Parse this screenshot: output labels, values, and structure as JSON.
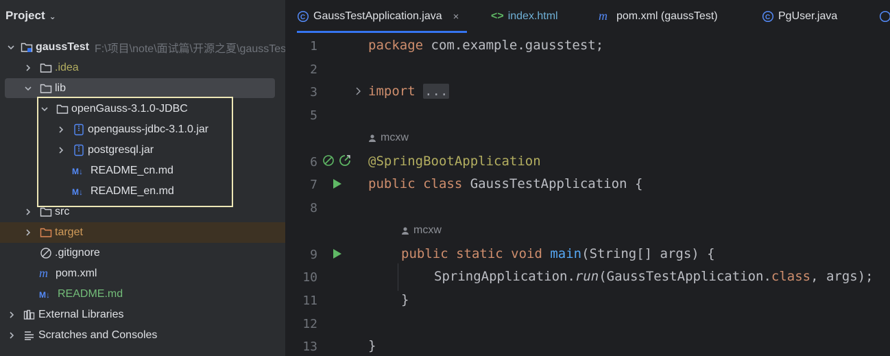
{
  "panel": {
    "title": "Project",
    "tree": [
      {
        "label": "gaussTest",
        "path": "F:\\项目\\note\\面试篇\\开源之夏\\gaussTest"
      },
      {
        "label": ".idea"
      },
      {
        "label": "lib"
      },
      {
        "label": "openGauss-3.1.0-JDBC"
      },
      {
        "label": "opengauss-jdbc-3.1.0.jar"
      },
      {
        "label": "postgresql.jar"
      },
      {
        "label": "README_cn.md"
      },
      {
        "label": "README_en.md"
      },
      {
        "label": "src"
      },
      {
        "label": "target"
      },
      {
        "label": ".gitignore"
      },
      {
        "label": "pom.xml"
      },
      {
        "label": "README.md"
      },
      {
        "label": "External Libraries"
      },
      {
        "label": "Scratches and Consoles"
      }
    ]
  },
  "tabs": [
    {
      "label": "GaussTestApplication.java",
      "close": "×"
    },
    {
      "label": "index.html"
    },
    {
      "label": "pom.xml (gaussTest)"
    },
    {
      "label": "PgUser.java"
    }
  ],
  "editor": {
    "gutter": [
      "1",
      "2",
      "3",
      "5",
      "6",
      "7",
      "8",
      "9",
      "10",
      "11",
      "12",
      "13"
    ],
    "author": "mcxw",
    "lines": {
      "l1_kw": "package",
      "l1_rest": " com.example.gausstest;",
      "l3_kw": "import",
      "l3_dots": "...",
      "l6": "@SpringBootApplication",
      "l7_kw": "public class",
      "l7_rest": " GaussTestApplication {",
      "l9_kw": "public static void",
      "l9_fn": "main",
      "l9_rest": "(String[] args) {",
      "l10_a": "SpringApplication.",
      "l10_run": "run",
      "l10_b": "(GaussTestApplication.",
      "l10_kw": "class",
      "l10_c": ", args);",
      "l11": "}",
      "l13": "}"
    }
  },
  "colors": {
    "keyword": "#cf8e6d",
    "annotation": "#b3ae60",
    "method": "#56a8f5",
    "highlight_box": "#ede7b6",
    "accent": "#3574f0"
  }
}
